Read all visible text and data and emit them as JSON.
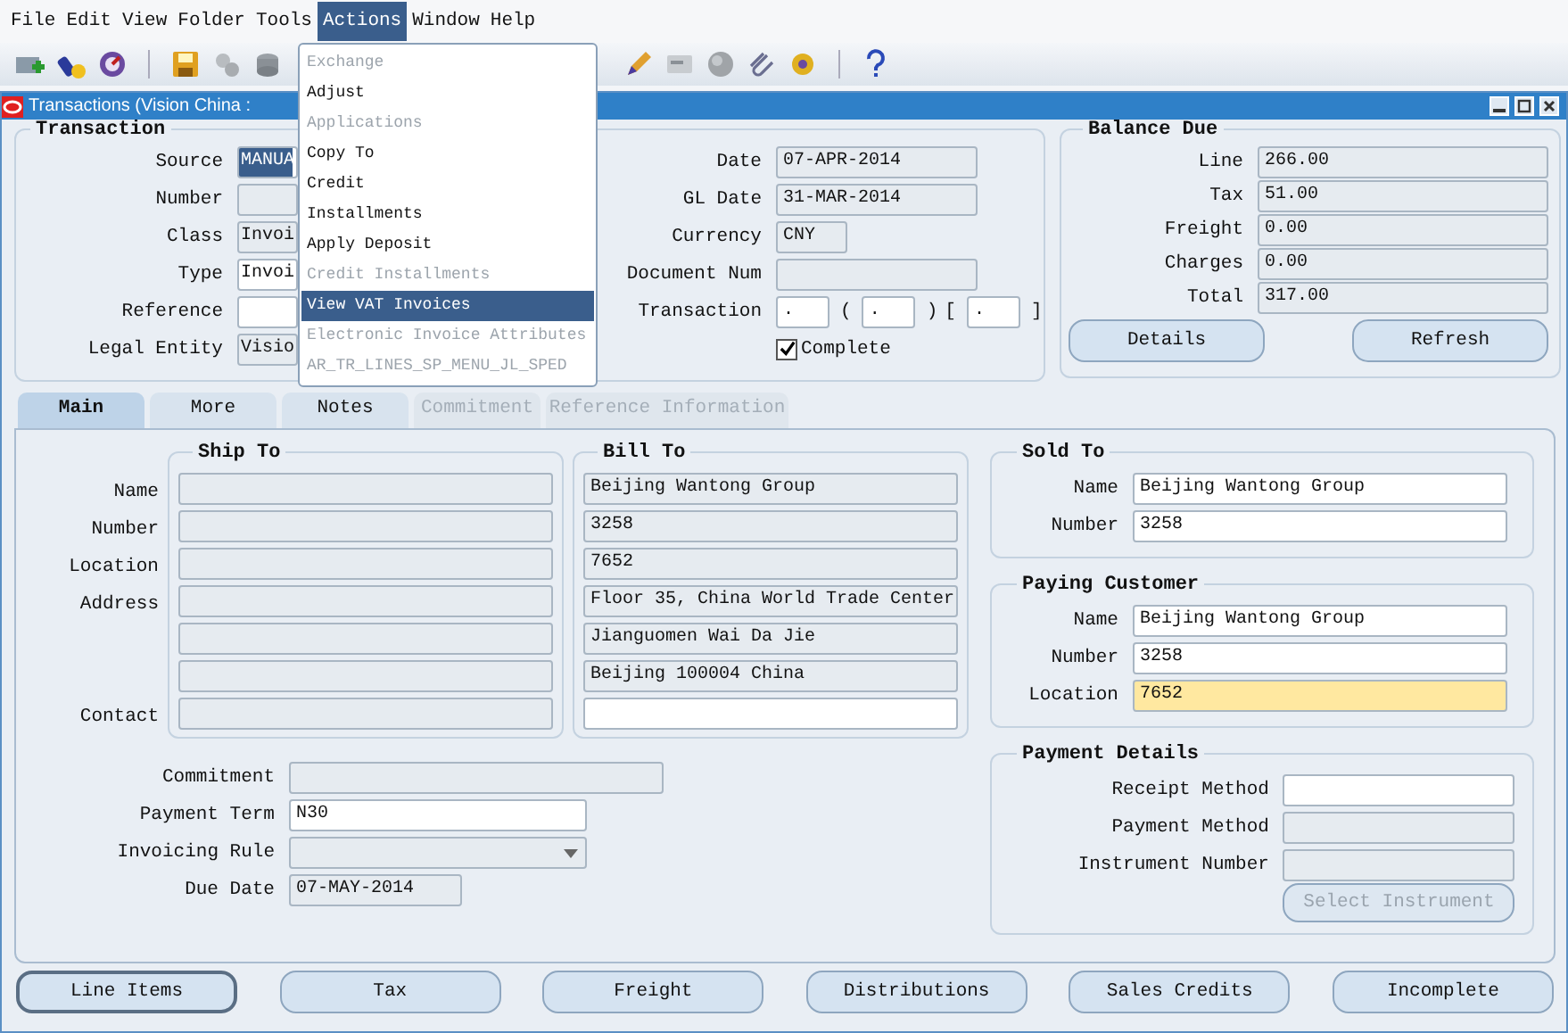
{
  "menubar": [
    {
      "label": "File",
      "selected": false
    },
    {
      "label": "Edit",
      "selected": false
    },
    {
      "label": "View",
      "selected": false
    },
    {
      "label": "Folder",
      "selected": false
    },
    {
      "label": "Tools",
      "selected": false
    },
    {
      "label": "Actions",
      "selected": true
    },
    {
      "label": "Window",
      "selected": false
    },
    {
      "label": "Help",
      "selected": false
    }
  ],
  "actions_menu": [
    {
      "label": "Exchange",
      "disabled": true,
      "selected": false
    },
    {
      "label": "Adjust",
      "disabled": false,
      "selected": false
    },
    {
      "label": "Applications",
      "disabled": true,
      "selected": false
    },
    {
      "label": "Copy To",
      "disabled": false,
      "selected": false
    },
    {
      "label": "Credit",
      "disabled": false,
      "selected": false
    },
    {
      "label": "Installments",
      "disabled": false,
      "selected": false
    },
    {
      "label": "Apply Deposit",
      "disabled": false,
      "selected": false
    },
    {
      "label": "Credit Installments",
      "disabled": true,
      "selected": false
    },
    {
      "label": "View VAT Invoices",
      "disabled": false,
      "selected": true
    },
    {
      "label": "Electronic Invoice Attributes",
      "disabled": true,
      "selected": false
    },
    {
      "label": "AR_TR_LINES_SP_MENU_JL_SPED",
      "disabled": true,
      "selected": false
    }
  ],
  "window": {
    "title": "Transactions (Vision China :"
  },
  "transaction": {
    "title": "Transaction",
    "fields": [
      {
        "label": "Source",
        "value": "MANUA",
        "kind": "highlighted"
      },
      {
        "label": "Number",
        "kind": "readonly"
      },
      {
        "label": "Class",
        "value": "Invoi",
        "kind": "readonly"
      },
      {
        "label": "Type",
        "value": "Invoi",
        "kind": "editable"
      },
      {
        "label": "Reference",
        "kind": "editable"
      },
      {
        "label": "Legal Entity",
        "value": "Visio",
        "kind": "readonly"
      }
    ],
    "dates": [
      {
        "label": "Date",
        "value": "07-APR-2014",
        "kind": "readonly"
      },
      {
        "label": "GL Date",
        "value": "31-MAR-2014",
        "kind": "readonly"
      },
      {
        "label": "Currency",
        "value": "CNY",
        "kind": "readonly"
      },
      {
        "label": "Document Num",
        "kind": "readonly"
      }
    ],
    "transaction_number": {
      "label": "Transaction",
      "parts": [
        {
          "kind": "field",
          "value": "."
        },
        {
          "kind": "text",
          "value": "("
        },
        {
          "kind": "field",
          "value": "."
        },
        {
          "kind": "text",
          "value": ")"
        },
        {
          "kind": "text",
          "value": "["
        },
        {
          "kind": "field",
          "value": "."
        },
        {
          "kind": "text",
          "value": "]"
        }
      ]
    },
    "complete": {
      "label": "Complete",
      "checked": true
    }
  },
  "balance_due": {
    "title": "Balance Due",
    "fields": [
      {
        "label": "Line",
        "value": "266.00"
      },
      {
        "label": "Tax",
        "value": "51.00"
      },
      {
        "label": "Freight",
        "value": "0.00"
      },
      {
        "label": "Charges",
        "value": "0.00"
      },
      {
        "label": "Total",
        "value": "317.00"
      }
    ],
    "buttons": [
      "Details",
      "Refresh"
    ]
  },
  "tabs": [
    {
      "label": "Main",
      "selected": true,
      "disabled": false
    },
    {
      "label": "More",
      "selected": false,
      "disabled": false
    },
    {
      "label": "Notes",
      "selected": false,
      "disabled": false
    },
    {
      "label": "Commitment",
      "selected": false,
      "disabled": true
    },
    {
      "label": "Reference Information",
      "selected": false,
      "disabled": true
    }
  ],
  "ship_to": {
    "title": "Ship To",
    "fields": [
      {
        "label": "Name",
        "kind": "readonly"
      },
      {
        "label": "Number",
        "kind": "readonly"
      },
      {
        "label": "Location",
        "kind": "readonly"
      },
      {
        "label": "Address",
        "kind": "readonly"
      },
      {
        "kind": "readonly"
      },
      {
        "kind": "readonly"
      },
      {
        "label": "Contact",
        "kind": "readonly"
      }
    ]
  },
  "bill_to": {
    "title": "Bill To",
    "fields": [
      {
        "value": "Beijing Wantong Group",
        "kind": "readonly"
      },
      {
        "value": "3258",
        "kind": "readonly"
      },
      {
        "value": "7652",
        "kind": "readonly"
      },
      {
        "value": "Floor 35, China World Trade Center",
        "kind": "readonly"
      },
      {
        "value": "Jianguomen Wai Da Jie",
        "kind": "readonly"
      },
      {
        "value": "Beijing 100004 China",
        "kind": "readonly"
      },
      {
        "kind": "editable"
      }
    ]
  },
  "sold_to": {
    "title": "Sold To",
    "fields": [
      {
        "label": "Name",
        "value": "Beijing Wantong Group",
        "kind": "editable"
      },
      {
        "label": "Number",
        "value": "3258",
        "kind": "editable"
      }
    ]
  },
  "paying_customer": {
    "title": "Paying Customer",
    "fields": [
      {
        "label": "Name",
        "value": "Beijing Wantong Group",
        "kind": "editable"
      },
      {
        "label": "Number",
        "value": "3258",
        "kind": "editable"
      },
      {
        "label": "Location",
        "value": "7652",
        "kind": "current"
      }
    ]
  },
  "terms": [
    {
      "label": "Commitment",
      "kind": "readonly"
    },
    {
      "label": "Payment Term",
      "value": "N30",
      "kind": "editable"
    },
    {
      "label": "Invoicing Rule",
      "kind": "dropdown"
    },
    {
      "label": "Due Date",
      "value": "07-MAY-2014",
      "kind": "readonly"
    }
  ],
  "payment_details": {
    "title": "Payment Details",
    "fields": [
      {
        "label": "Receipt Method",
        "kind": "editable"
      },
      {
        "label": "Payment Method",
        "kind": "readonly"
      },
      {
        "label": "Instrument Number",
        "kind": "readonly"
      }
    ],
    "button": {
      "label": "Select Instrument",
      "disabled": true
    }
  },
  "bottom_buttons": [
    {
      "label": "Line Items",
      "selected": true
    },
    {
      "label": "Tax",
      "selected": false
    },
    {
      "label": "Freight",
      "selected": false
    },
    {
      "label": "Distributions",
      "selected": false
    },
    {
      "label": "Sales Credits",
      "selected": false
    },
    {
      "label": "Incomplete",
      "selected": false
    }
  ]
}
